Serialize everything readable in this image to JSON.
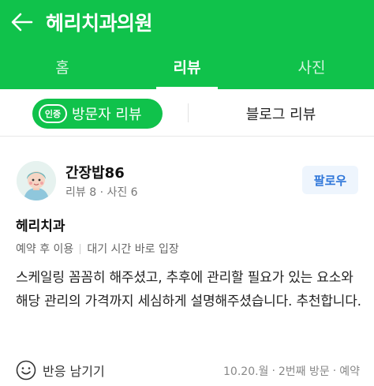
{
  "header": {
    "title": "헤리치과의원"
  },
  "tabs": [
    {
      "label": "홈"
    },
    {
      "label": "리뷰"
    },
    {
      "label": "사진"
    }
  ],
  "subtabs": {
    "badge": "인증",
    "visitor_label": "방문자 리뷰",
    "blog_label": "블로그 리뷰"
  },
  "review": {
    "username": "간장밥86",
    "stats": "리뷰 8 · 사진 6",
    "follow_label": "팔로우",
    "place": "헤리치과",
    "tags": [
      "예약 후 이용",
      "대기 시간 바로 입장"
    ],
    "text": "스케일링 꼼꼼히 해주셨고, 추후에 관리할 필요가 있는 요소와 해당 관리의 가격까지 세심하게 설명해주셨습니다. 추천합니다.",
    "react_label": "반응 남기기",
    "meta": [
      "10.20.월",
      "2번째 방문",
      "예약"
    ]
  },
  "colors": {
    "brand_green": "#10c24b",
    "follow_blue": "#2e76d9"
  }
}
